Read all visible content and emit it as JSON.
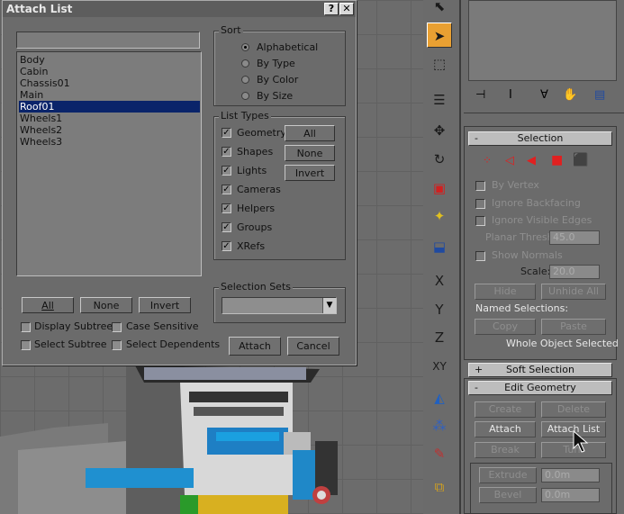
{
  "dialog": {
    "title": "Attach List",
    "help_glyph": "?",
    "close_glyph": "✕",
    "search_value": "",
    "objects": [
      "Body",
      "Cabin",
      "Chassis01",
      "Main",
      "Roof01",
      "Wheels1",
      "Wheels2",
      "Wheels3"
    ],
    "selected_index": 4,
    "all_label": "All",
    "none_label": "None",
    "invert_label": "Invert",
    "display_subtree": "Display Subtree",
    "case_sensitive": "Case Sensitive",
    "select_subtree": "Select Subtree",
    "select_dependents": "Select Dependents",
    "sort": {
      "label": "Sort",
      "options": [
        "Alphabetical",
        "By Type",
        "By Color",
        "By Size"
      ],
      "selected": 0
    },
    "list_types": {
      "label": "List Types",
      "items": [
        "Geometry",
        "Shapes",
        "Lights",
        "Cameras",
        "Helpers",
        "Groups",
        "XRefs"
      ],
      "checked": [
        true,
        true,
        true,
        true,
        true,
        true,
        true
      ],
      "all_label": "All",
      "none_label": "None",
      "invert_label": "Invert"
    },
    "selection_sets": {
      "label": "Selection Sets",
      "value": ""
    },
    "attach_label": "Attach",
    "cancel_label": "Cancel"
  },
  "panel": {
    "selection": {
      "collapse": "-",
      "title": "Selection",
      "by_vertex": "By Vertex",
      "ignore_backfacing": "Ignore Backfacing",
      "ignore_visible_edges": "Ignore Visible Edges",
      "planar_thresh_label": "Planar Thresh:",
      "planar_thresh_value": "45.0",
      "show_normals": "Show Normals",
      "scale_label": "Scale:",
      "scale_value": "20.0",
      "hide": "Hide",
      "unhide_all": "Unhide All",
      "named_selections": "Named Selections:",
      "copy": "Copy",
      "paste": "Paste",
      "status": "Whole Object Selected"
    },
    "soft_selection": {
      "expand": "+",
      "title": "Soft Selection"
    },
    "edit_geometry": {
      "collapse": "-",
      "title": "Edit Geometry",
      "create": "Create",
      "delete": "Delete",
      "attach": "Attach",
      "attach_list": "Attach List",
      "break": "Break",
      "turn": "Turn",
      "extrude": "Extrude",
      "extrude_value": "0.0m",
      "bevel": "Bevel",
      "bevel_value": "0.0m"
    }
  },
  "colors": {
    "accent": "#0a246a",
    "active_tool": "#f0a030",
    "subobj_red": "#e02020"
  }
}
